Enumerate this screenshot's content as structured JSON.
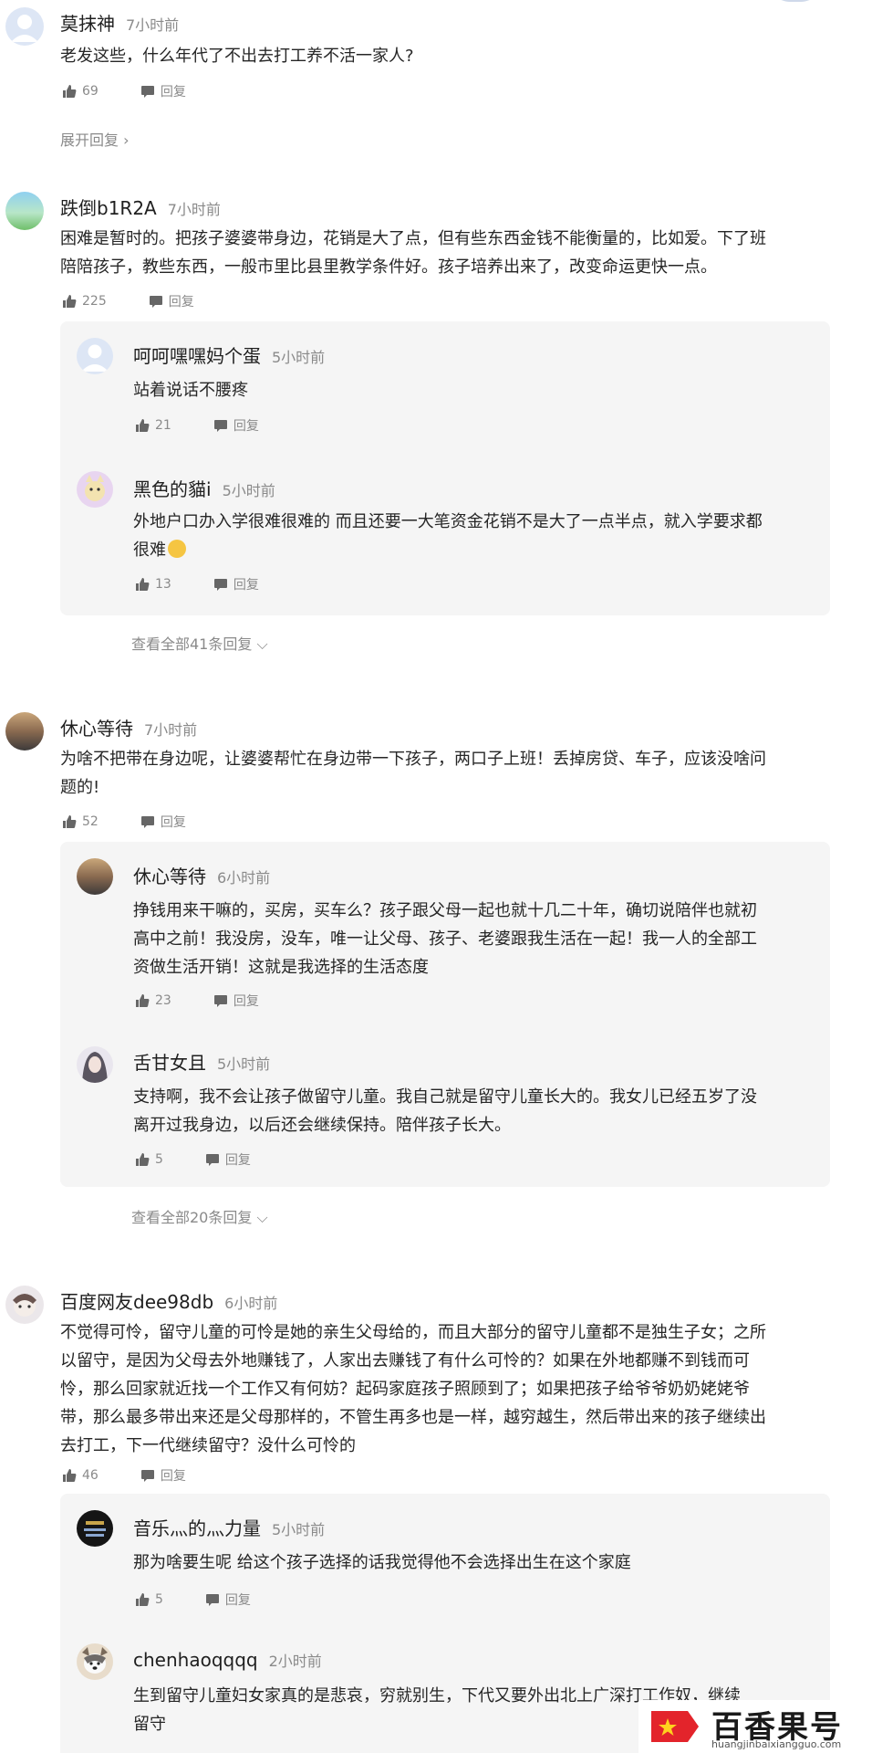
{
  "reply_label": "回复",
  "comments": [
    {
      "name": "莫抹神",
      "time": "7小时前",
      "lines": [
        "老发这些，什么年代了不出去打工养不活一家人?"
      ],
      "likes": "69",
      "expand": "展开回复"
    },
    {
      "name": "跌倒b1R2A",
      "time": "7小时前",
      "lines": [
        "困难是暂时的。把孩子婆婆带身边，花销是大了点，但有些东西金钱不能衡量的，比如爱。下了班",
        "陪陪孩子，教些东西，一般市里比县里教学条件好。孩子培养出来了，改变命运更快一点。"
      ],
      "likes": "225",
      "replies": [
        {
          "name": "呵呵嘿嘿妈个蛋",
          "time": "5小时前",
          "lines": [
            "站着说话不腰疼"
          ],
          "likes": "21"
        },
        {
          "name": "黑色的貓i",
          "time": "5小时前",
          "lines": [
            "外地户口办入学很难很难的 而且还要一大笔资金花销不是大了一点半点，就入学要求都",
            "很难"
          ],
          "likes": "13"
        }
      ],
      "view_all": "查看全部41条回复"
    },
    {
      "name": "休心等待",
      "time": "7小时前",
      "lines": [
        "为啥不把带在身边呢，让婆婆帮忙在身边带一下孩子，两口子上班！丢掉房贷、车子，应该没啥问",
        "题的!"
      ],
      "likes": "52",
      "replies": [
        {
          "name": "休心等待",
          "time": "6小时前",
          "lines": [
            "挣钱用来干嘛的，买房，买车么？孩子跟父母一起也就十几二十年，确切说陪伴也就初",
            "高中之前！我没房，没车，唯一让父母、孩子、老婆跟我生活在一起！我一人的全部工",
            "资做生活开销！这就是我选择的生活态度"
          ],
          "likes": "23"
        },
        {
          "name": "舌甘女且",
          "time": "5小时前",
          "lines": [
            "支持啊，我不会让孩子做留守儿童。我自己就是留守儿童长大的。我女儿已经五岁了没",
            "离开过我身边，以后还会继续保持。陪伴孩子长大。"
          ],
          "likes": "5"
        }
      ],
      "view_all": "查看全部20条回复"
    },
    {
      "name": "百度网友dee98db",
      "time": "6小时前",
      "lines": [
        "不觉得可怜，留守儿童的可怜是她的亲生父母给的，而且大部分的留守儿童都不是独生子女；之所",
        "以留守，是因为父母去外地赚钱了，人家出去赚钱了有什么可怜的？如果在外地都赚不到钱而可",
        "怜，那么回家就近找一个工作又有何妨？起码家庭孩子照顾到了；如果把孩子给爷爷奶奶姥姥爷",
        "带，那么最多带出来还是父母那样的，不管生再多也是一样，越穷越生，然后带出来的孩子继续出",
        "去打工，下一代继续留守？没什么可怜的"
      ],
      "likes": "46",
      "replies": [
        {
          "name": "音乐灬的灬力量",
          "time": "5小时前",
          "lines": [
            "那为啥要生呢 给这个孩子选择的话我觉得他不会选择出生在这个家庭"
          ],
          "likes": "5"
        },
        {
          "name": "chenhaoqqqq",
          "time": "2小时前",
          "lines": [
            "生到留守儿童妇女家真的是悲哀，穷就别生，下代又要外出北上广深打工作奴，继续",
            "留守"
          ],
          "likes": ""
        }
      ]
    }
  ],
  "watermark": {
    "title": "百香果号",
    "url": "huangjinbaixiangguo.com"
  },
  "colors": {
    "background": "#ffffff",
    "reply_bg": "#f5f5f5",
    "muted": "#8a8a8a",
    "text": "#262626",
    "brand_red": "#e3242b"
  }
}
